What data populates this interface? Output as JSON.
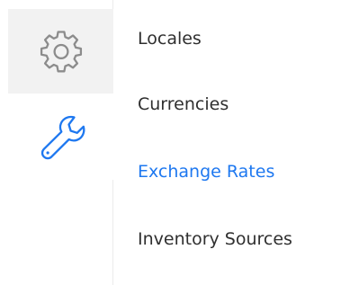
{
  "sidebar": {
    "icons": [
      {
        "name": "gear-icon",
        "state": "selected"
      },
      {
        "name": "wrench-icon",
        "state": "active"
      }
    ]
  },
  "submenu": {
    "items": [
      {
        "label": "Locales",
        "active": false
      },
      {
        "label": "Currencies",
        "active": false
      },
      {
        "label": "Exchange Rates",
        "active": true
      },
      {
        "label": "Inventory Sources",
        "active": false
      }
    ]
  },
  "colors": {
    "accent": "#1e78f0",
    "text": "#2f2f2f",
    "icon_muted": "#8c8c8c",
    "selected_bg": "#f2f2f2"
  }
}
